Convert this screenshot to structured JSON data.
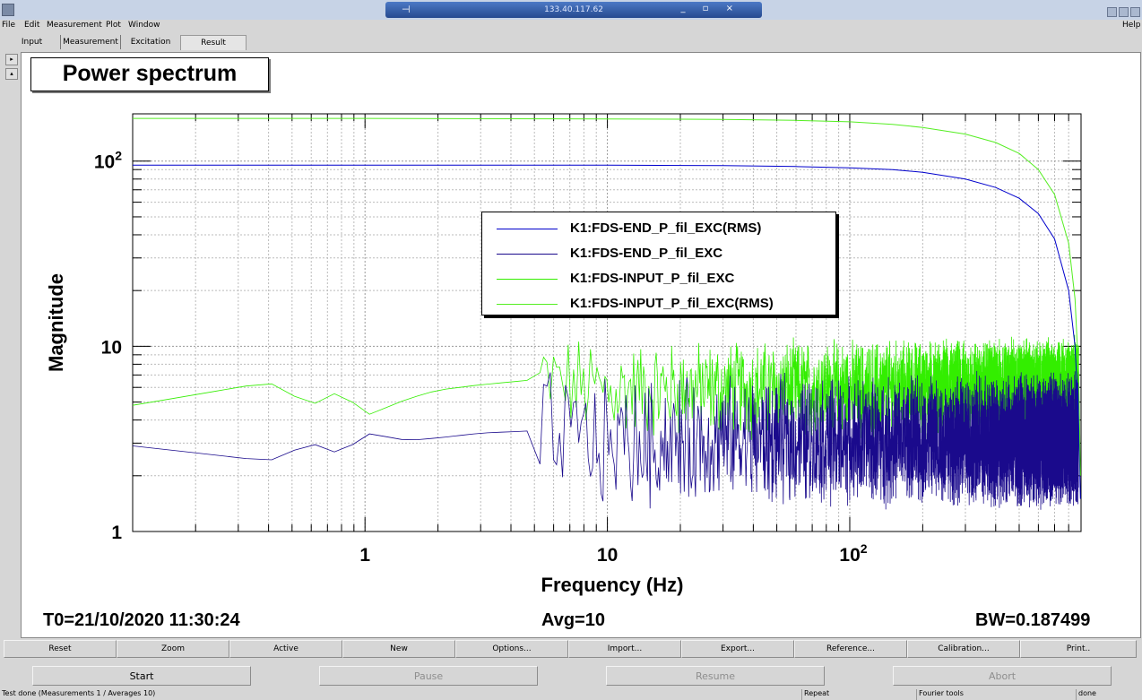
{
  "window": {
    "title": "133.40.117.62",
    "pin": "⊣",
    "controls": "_ ▫ ×"
  },
  "menu": {
    "file": "File",
    "edit": "Edit",
    "measurement": "Measurement",
    "plot": "Plot",
    "window": "Window",
    "help": "Help"
  },
  "tabs": {
    "input": "Input",
    "measurement": "Measurement",
    "excitation": "Excitation",
    "result": "Result"
  },
  "side_buttons": {
    "expand": "▸",
    "collapse": "▴"
  },
  "pane": {
    "title": "Power spectrum"
  },
  "info": {
    "t0": "T0=21/10/2020 11:30:24",
    "avg": "Avg=10",
    "bw": "BW=0.187499"
  },
  "buttons_row1": {
    "reset": "Reset",
    "zoom": "Zoom",
    "active": "Active",
    "new": "New",
    "options": "Options...",
    "import": "Import...",
    "export": "Export...",
    "reference": "Reference...",
    "calibration": "Calibration...",
    "print": "Print.."
  },
  "buttons_row2": {
    "start": "Start",
    "pause": "Pause",
    "resume": "Resume",
    "abort": "Abort"
  },
  "status": {
    "message": "Test done (Measurements 1 / Averages 10)",
    "repeat": "Repeat",
    "fourier": "Fourier tools",
    "done": "done"
  },
  "chart_data": {
    "type": "line",
    "xlabel": "Frequency (Hz)",
    "ylabel": "Magnitude",
    "x_scale": "log",
    "y_scale": "log",
    "xlim": [
      0.11,
      900
    ],
    "ylim": [
      1,
      180
    ],
    "x_ticks": [
      {
        "value": 1,
        "label": "1",
        "sup": ""
      },
      {
        "value": 10,
        "label": "10",
        "sup": ""
      },
      {
        "value": 100,
        "label": "10",
        "sup": "2"
      }
    ],
    "y_ticks": [
      {
        "value": 1,
        "label": "1",
        "sup": ""
      },
      {
        "value": 10,
        "label": "10",
        "sup": ""
      },
      {
        "value": 100,
        "label": "10",
        "sup": "2"
      }
    ],
    "grid": true,
    "legend_position": "center",
    "series": [
      {
        "name": "K1:FDS-END_P_fil_EXC(RMS)",
        "color": "#0000cc",
        "x": [
          0.11,
          1,
          10,
          30,
          60,
          100,
          150,
          200,
          300,
          400,
          500,
          600,
          700,
          800,
          850,
          880,
          895
        ],
        "y": [
          95,
          95,
          95,
          94.5,
          93.5,
          92,
          90,
          87,
          80,
          72,
          63,
          52,
          38,
          20,
          10,
          4,
          1.5
        ]
      },
      {
        "name": "K1:FDS-END_P_fil_EXC",
        "color": "#1a0a8c",
        "noise": 0.18,
        "x": [
          0.11,
          0.4,
          0.6,
          0.8,
          1,
          1.5,
          2,
          3,
          5,
          10,
          30,
          100,
          300,
          880
        ],
        "y": [
          2.9,
          2.4,
          3.0,
          2.6,
          3.4,
          3.1,
          3.2,
          3.4,
          3.5,
          3.0,
          3.1,
          3.1,
          3.1,
          3.1
        ]
      },
      {
        "name": "K1:FDS-INPUT_P_fil_EXC",
        "color": "#33ee00",
        "noise": 0.14,
        "x": [
          0.11,
          0.4,
          0.6,
          0.8,
          1,
          1.5,
          2,
          3,
          5,
          10,
          30,
          100,
          300,
          880
        ],
        "y": [
          4.8,
          6.4,
          4.8,
          5.8,
          4.2,
          5.2,
          5.8,
          6.2,
          6.6,
          5.8,
          5.8,
          5.8,
          5.8,
          5.9
        ]
      },
      {
        "name": "K1:FDS-INPUT_P_fil_EXC(RMS)",
        "color": "#55ee22",
        "x": [
          0.11,
          1,
          10,
          30,
          60,
          100,
          150,
          200,
          300,
          400,
          500,
          600,
          700,
          800,
          850,
          880,
          895
        ],
        "y": [
          170,
          170,
          169,
          168,
          166,
          163,
          158,
          152,
          140,
          126,
          110,
          90,
          66,
          36,
          18,
          7,
          2
        ]
      }
    ]
  }
}
